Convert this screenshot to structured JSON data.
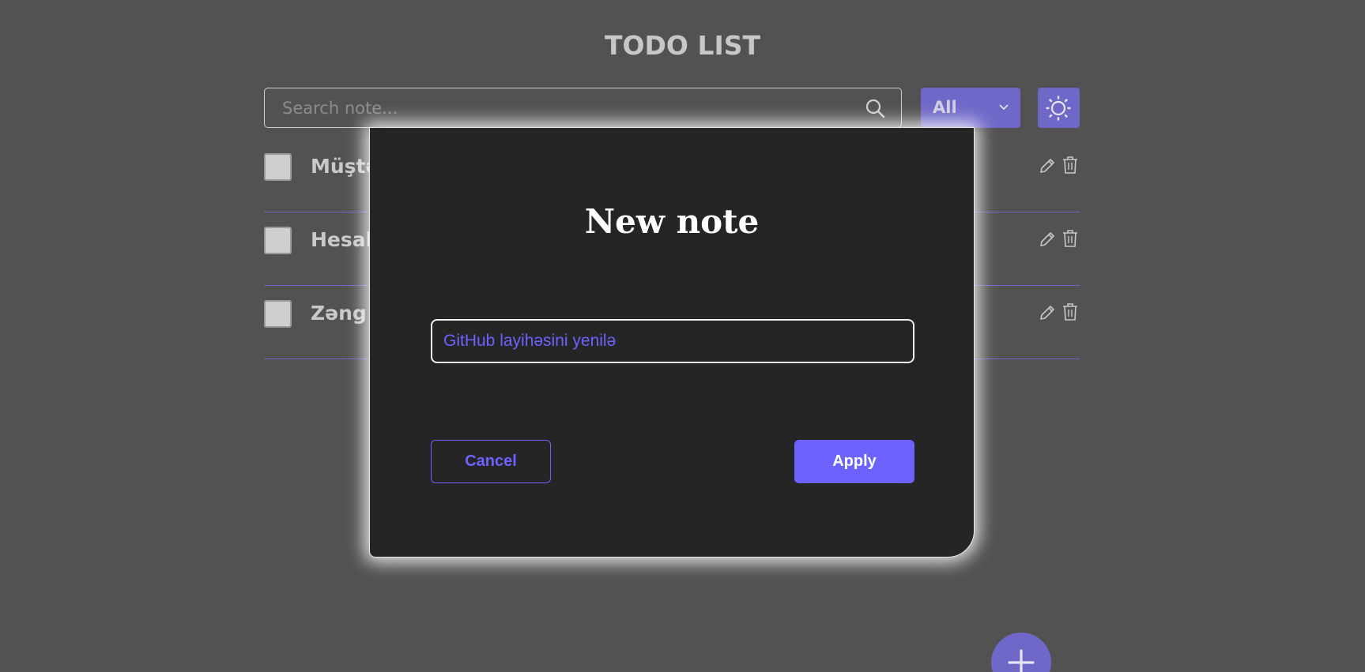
{
  "app": {
    "title": "TODO LIST"
  },
  "search": {
    "placeholder": "Search note...",
    "value": ""
  },
  "filter": {
    "selected": "All"
  },
  "todos": [
    {
      "text": "Müştə",
      "checked": false
    },
    {
      "text": "Hesab",
      "checked": false
    },
    {
      "text": "Zəng g",
      "checked": false
    }
  ],
  "modal": {
    "title": "New note",
    "input_value": "GitHub layihəsini yenilə",
    "cancel_label": "Cancel",
    "apply_label": "Apply"
  },
  "icons": {
    "search": "search-icon",
    "filter_chevron": "chevron-down-icon",
    "theme": "sun-icon",
    "edit": "pencil-icon",
    "delete": "trash-icon",
    "add": "plus-icon"
  },
  "colors": {
    "background": "#525252",
    "accent": "#6c63ff",
    "accent_muted": "#6f68c8",
    "modal_bg": "#252525"
  }
}
